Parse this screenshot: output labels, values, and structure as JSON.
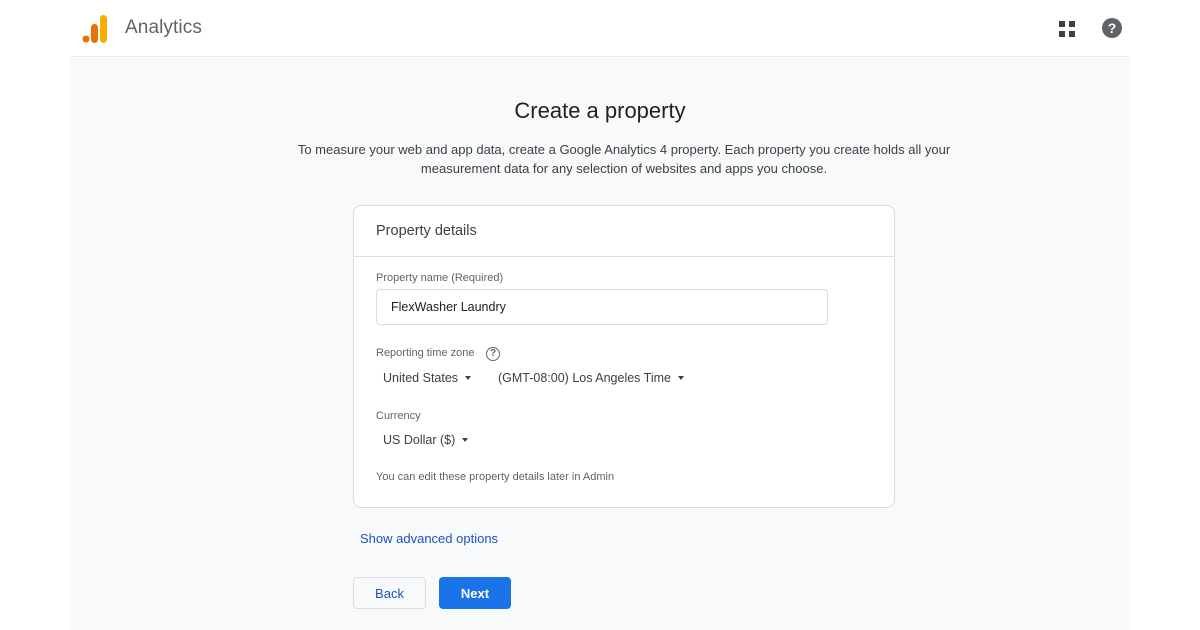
{
  "progress": {
    "fraction": 0.2,
    "color": "#1a73e8"
  },
  "header": {
    "app_title": "Analytics",
    "logo_icon": "google-analytics-logo",
    "apps_icon": "apps-grid-icon",
    "help_icon": "help-icon",
    "help_glyph": "?"
  },
  "main": {
    "title": "Create a property",
    "description": "To measure your web and app data, create a Google Analytics 4 property. Each property you create holds all your measurement data for any selection of websites and apps you choose."
  },
  "card": {
    "header": "Property details",
    "property_name": {
      "label": "Property name (Required)",
      "value": "FlexWasher Laundry"
    },
    "time_zone": {
      "label": "Reporting time zone",
      "help_glyph": "?",
      "country": "United States",
      "zone": "(GMT-08:00) Los Angeles Time"
    },
    "currency": {
      "label": "Currency",
      "value": "US Dollar ($)"
    },
    "hint": "You can edit these property details later in Admin"
  },
  "advanced_link": "Show advanced options",
  "buttons": {
    "back": "Back",
    "next": "Next"
  },
  "colors": {
    "primary": "#1a73e8",
    "link": "#1a55c0",
    "logo_dark": "#e37400",
    "logo_light": "#f9ab00"
  }
}
